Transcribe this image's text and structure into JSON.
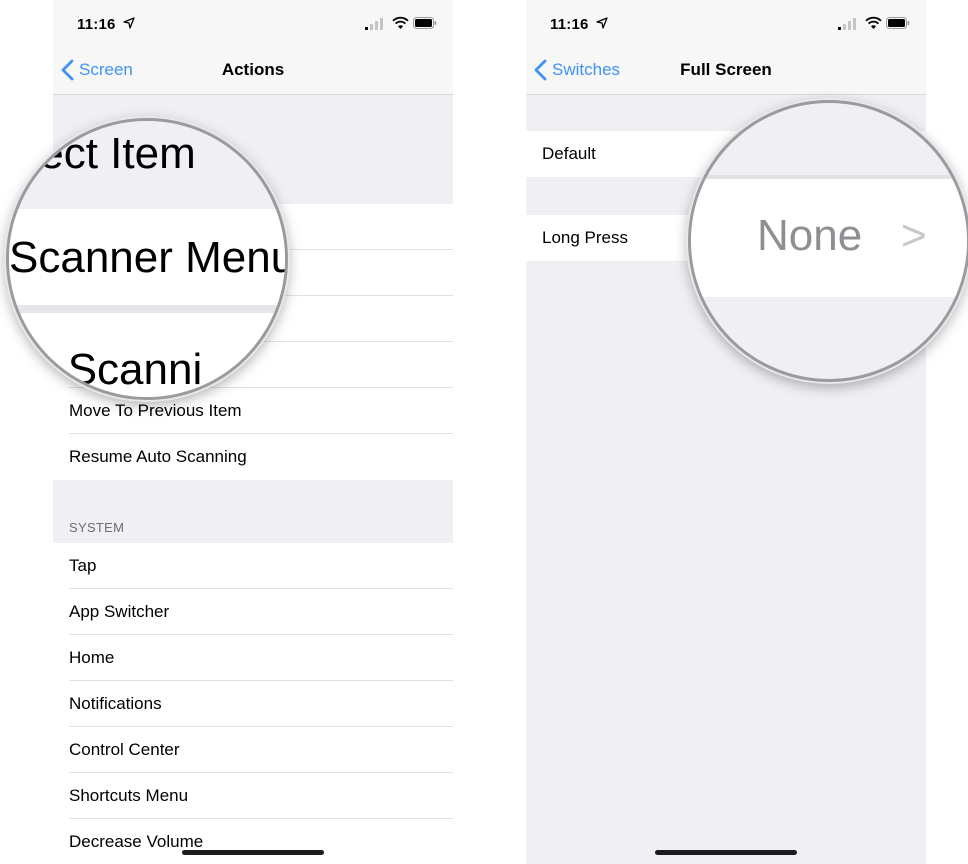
{
  "status_bar": {
    "time": "11:16"
  },
  "left_screen": {
    "back_label": "Screen",
    "title": "Actions",
    "visible_items": [
      "Move To Previous Item",
      "Resume Auto Scanning"
    ],
    "system_header": "SYSTEM",
    "system_items": [
      "Tap",
      "App Switcher",
      "Home",
      "Notifications",
      "Control Center",
      "Shortcuts Menu",
      "Decrease Volume"
    ],
    "magnifier": {
      "line1": "elect Item",
      "line2": "Scanner Menu",
      "line3": "p Scanni"
    }
  },
  "right_screen": {
    "back_label": "Switches",
    "title": "Full Screen",
    "rows": [
      "Default",
      "Long Press"
    ],
    "magnifier": {
      "value": "None",
      "chevron": ">"
    }
  },
  "colors": {
    "accent": "#3f93f6",
    "background": "#efeff4",
    "secondary_text": "#8e8e93"
  }
}
